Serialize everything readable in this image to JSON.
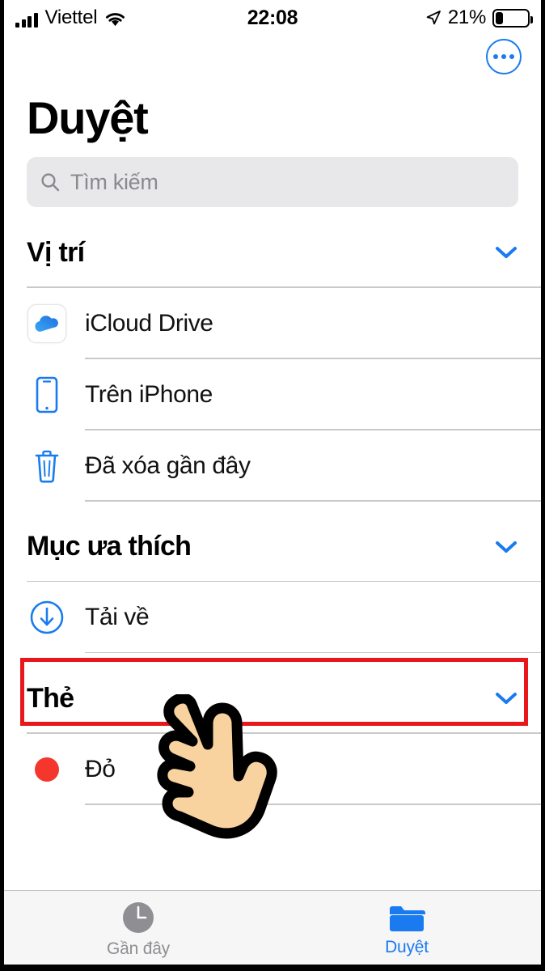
{
  "status_bar": {
    "carrier": "Viettel",
    "signal_bars": 4,
    "wifi_icon": "wifi-icon",
    "time": "22:08",
    "location_icon": "location-arrow-icon",
    "battery_percent": "21%",
    "battery_level": 21
  },
  "navbar": {
    "more_button_icon": "ellipsis-circle-icon"
  },
  "header": {
    "title": "Duyệt"
  },
  "search": {
    "icon": "search-icon",
    "placeholder": "Tìm kiếm",
    "value": ""
  },
  "sections": [
    {
      "title": "Vị trí",
      "collapse_icon": "chevron-down-icon",
      "rows": [
        {
          "label": "iCloud Drive",
          "icon": "icloud-drive-icon"
        },
        {
          "label": "Trên iPhone",
          "icon": "iphone-icon"
        },
        {
          "label": "Đã xóa gần đây",
          "icon": "trash-icon"
        }
      ]
    },
    {
      "title": "Mục ưa thích",
      "collapse_icon": "chevron-down-icon",
      "rows": [
        {
          "label": "Tải về",
          "icon": "download-circle-icon",
          "highlighted": true
        }
      ]
    },
    {
      "title": "Thẻ",
      "collapse_icon": "chevron-down-icon",
      "rows": [
        {
          "label": "Đỏ",
          "icon": "red-tag-dot"
        }
      ]
    }
  ],
  "annotations": {
    "highlight_color": "#E8171B",
    "cursor_icon": "pointing-hand-cursor"
  },
  "tabbar": {
    "tabs": [
      {
        "label": "Gần đây",
        "icon": "clock-icon",
        "active": false
      },
      {
        "label": "Duyệt",
        "icon": "folder-icon",
        "active": true
      }
    ]
  },
  "colors": {
    "accent": "#1A7BF0",
    "tag_red": "#F5362C",
    "highlight_red": "#E8171B",
    "search_bg": "#E8E8EA"
  }
}
